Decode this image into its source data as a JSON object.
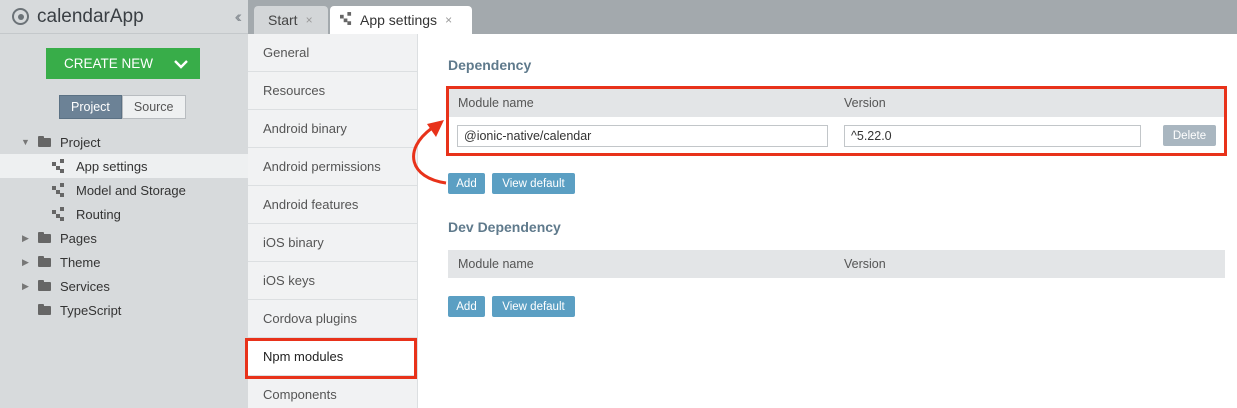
{
  "app": {
    "title": "calendarApp",
    "collapse_icon": "double-chevron-left"
  },
  "create_new": {
    "label": "CREATE NEW",
    "color": "#38ad49"
  },
  "project_tabs": [
    {
      "label": "Project",
      "active": true
    },
    {
      "label": "Source",
      "active": false
    }
  ],
  "tree": [
    {
      "label": "Project",
      "type": "folder",
      "expanded": true,
      "level": 0
    },
    {
      "label": "App settings",
      "type": "doc",
      "level": 1,
      "selected": true
    },
    {
      "label": "Model and Storage",
      "type": "doc",
      "level": 1
    },
    {
      "label": "Routing",
      "type": "doc",
      "level": 1
    },
    {
      "label": "Pages",
      "type": "folder",
      "expanded": false,
      "level": 0
    },
    {
      "label": "Theme",
      "type": "folder",
      "expanded": false,
      "level": 0
    },
    {
      "label": "Services",
      "type": "folder",
      "expanded": false,
      "level": 0
    },
    {
      "label": "TypeScript",
      "type": "folder",
      "level": 0
    }
  ],
  "tabs": [
    {
      "label": "Start",
      "close": "×"
    },
    {
      "label": "App settings",
      "close": "×",
      "active": true
    }
  ],
  "settings_nav": [
    {
      "label": "General"
    },
    {
      "label": "Resources"
    },
    {
      "label": "Android binary"
    },
    {
      "label": "Android permissions"
    },
    {
      "label": "Android features"
    },
    {
      "label": "iOS binary"
    },
    {
      "label": "iOS keys"
    },
    {
      "label": "Cordova plugins"
    },
    {
      "label": "Npm modules",
      "active": true
    },
    {
      "label": "Components"
    }
  ],
  "dependency": {
    "title": "Dependency",
    "col_module": "Module name",
    "col_version": "Version",
    "rows": [
      {
        "module": "@ionic-native/calendar",
        "version": "^5.22.0",
        "delete_label": "Delete"
      }
    ],
    "add_label": "Add",
    "view_default_label": "View default"
  },
  "dev_dependency": {
    "title": "Dev Dependency",
    "col_module": "Module name",
    "col_version": "Version",
    "add_label": "Add",
    "view_default_label": "View default"
  },
  "colors": {
    "accent": "#5b9fc3",
    "highlight": "#e8321a",
    "section_title": "#5f7a8c"
  }
}
